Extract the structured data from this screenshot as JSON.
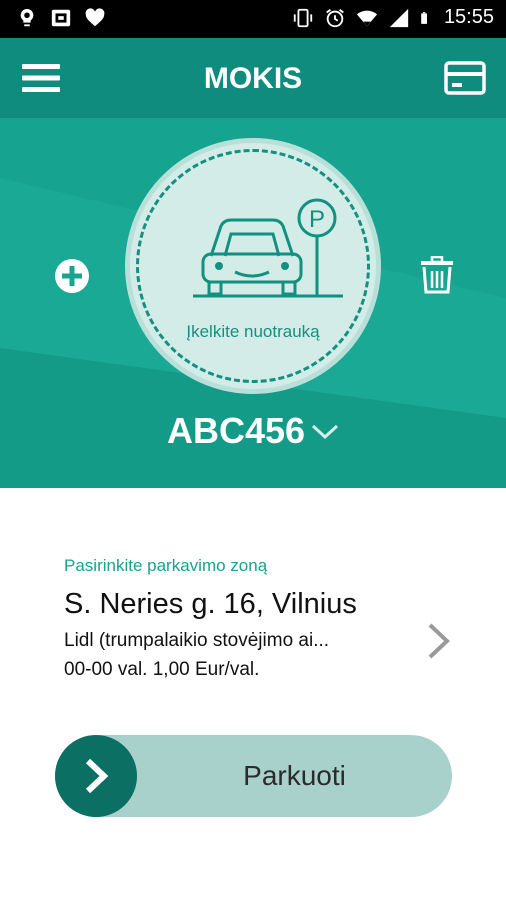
{
  "status_bar": {
    "time": "15:55",
    "left_icons": [
      "lightbulb-icon",
      "photo-badge-icon",
      "heart-icon"
    ],
    "right_icons": [
      "vibrate-icon",
      "alarm-icon",
      "wifi-icon",
      "signal-icon",
      "battery-icon"
    ]
  },
  "app_bar": {
    "title": "MOKIS",
    "menu_icon": "hamburger-menu-icon",
    "card_icon": "credit-card-icon"
  },
  "vehicle": {
    "photo_prompt": "Įkelkite nuotrauką",
    "plate": "ABC456",
    "add_icon": "plus-circle-icon",
    "delete_icon": "trash-icon"
  },
  "zone": {
    "caption": "Pasirinkite parkavimo zoną",
    "address": "S. Neries g. 16, Vilnius",
    "description": "Lidl (trumpalaikio stovėjimo ai...",
    "price": "00-00 val. 1,00 Eur/val."
  },
  "park": {
    "label": "Parkuoti"
  },
  "colors": {
    "app_bar": "#0f8c7d",
    "hero": "#16a38f",
    "accent_dark": "#0b6f63",
    "slider_track": "#a9d1cc"
  }
}
